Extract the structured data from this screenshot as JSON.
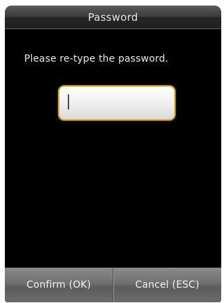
{
  "header": {
    "title": "Password"
  },
  "prompt": {
    "text": "Please re-type the password."
  },
  "password_input": {
    "value": "",
    "accent_color": "#e0a62a"
  },
  "footer": {
    "confirm_label": "Confirm (OK)",
    "cancel_label": "Cancel (ESC)"
  }
}
